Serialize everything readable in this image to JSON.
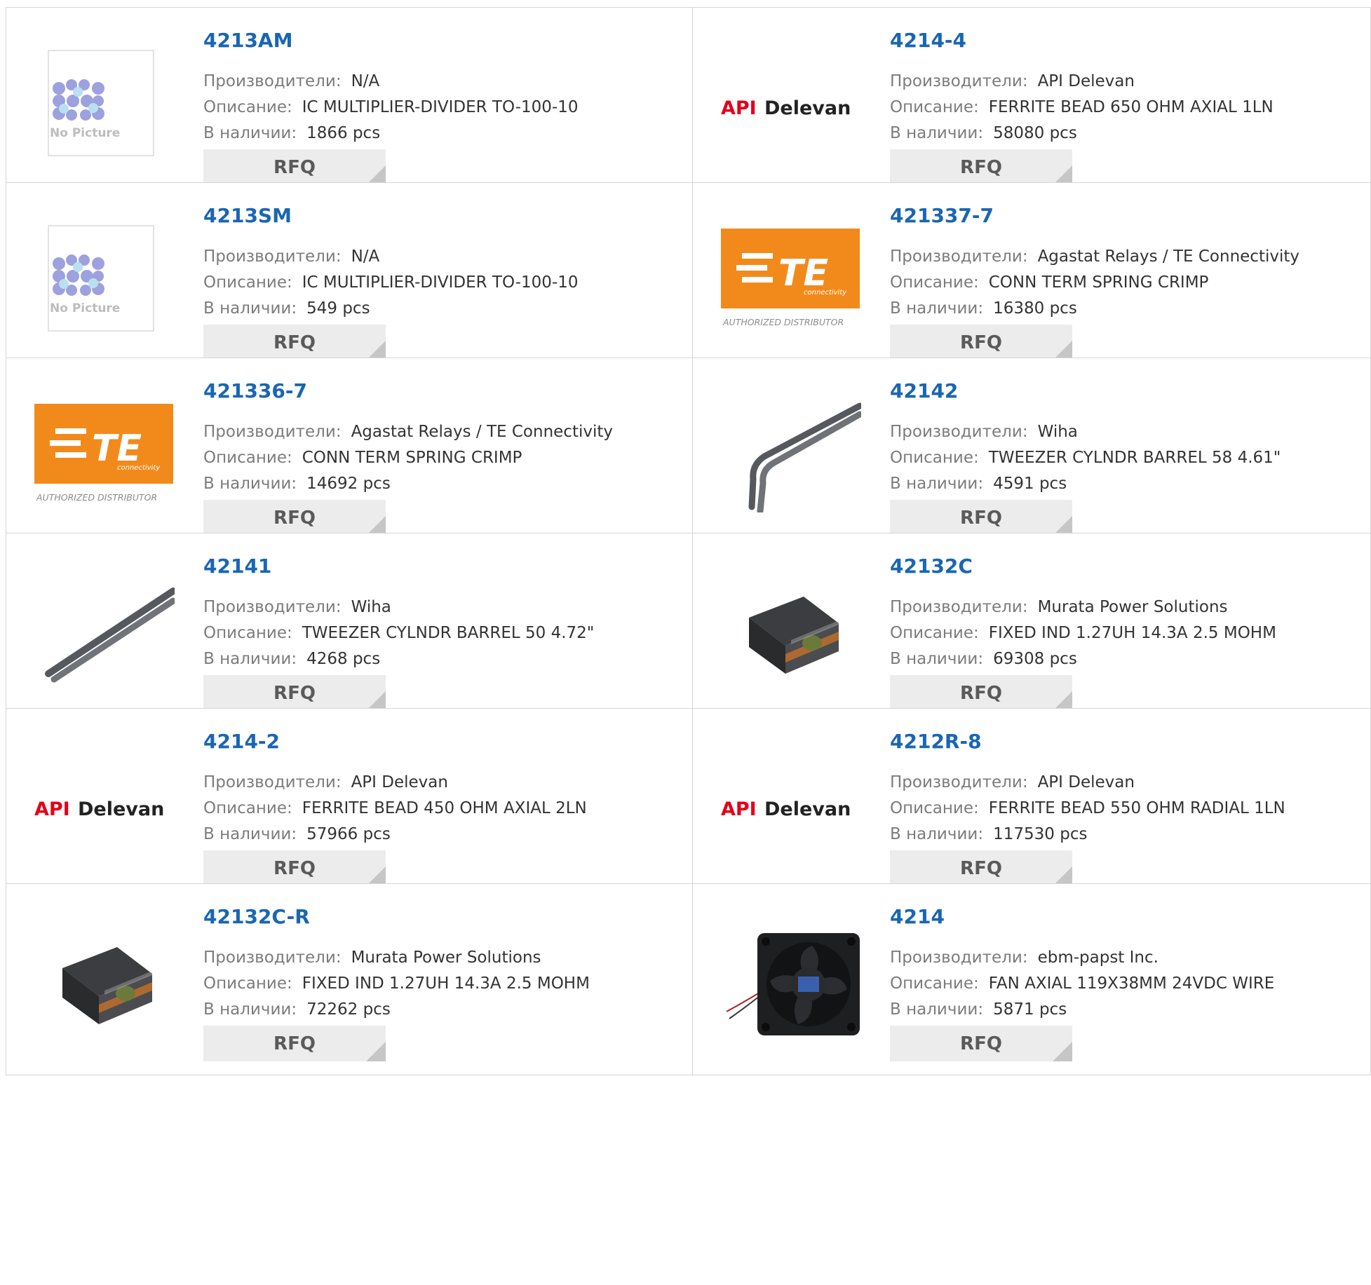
{
  "labels": {
    "manufacturer": "Производители:",
    "description": "Описание:",
    "stock": "В наличии:",
    "rfq": "RFQ"
  },
  "colors": {
    "part_link": "#1a66b3",
    "label": "#7c7c7c",
    "value": "#333333",
    "rfq_bg": "#ececec",
    "te_orange": "#f28a1b",
    "api_red": "#e3001b"
  },
  "image_texts": {
    "no_picture": "No Picture",
    "api": "API",
    "delevan": "Delevan",
    "te_name": "TE",
    "te_sub": "connectivity",
    "te_authorized": "AUTHORIZED DISTRIBUTOR"
  },
  "rows": [
    {
      "left": {
        "part": "4213AM",
        "manufacturer": "N/A",
        "description": "IC MULTIPLIER-DIVIDER TO-100-10",
        "stock": "1866 pcs",
        "image": "no-picture"
      },
      "right": {
        "part": "4214-4",
        "manufacturer": "API Delevan",
        "description": "FERRITE BEAD 650 OHM AXIAL 1LN",
        "stock": "58080 pcs",
        "image": "api-delevan-logo"
      }
    },
    {
      "left": {
        "part": "4213SM",
        "manufacturer": "N/A",
        "description": "IC MULTIPLIER-DIVIDER TO-100-10",
        "stock": "549 pcs",
        "image": "no-picture"
      },
      "right": {
        "part": "421337-7",
        "manufacturer": "Agastat Relays / TE Connectivity",
        "description": "CONN TERM SPRING CRIMP",
        "stock": "16380 pcs",
        "image": "te-logo"
      }
    },
    {
      "left": {
        "part": "421336-7",
        "manufacturer": "Agastat Relays / TE Connectivity",
        "description": "CONN TERM SPRING CRIMP",
        "stock": "14692 pcs",
        "image": "te-logo"
      },
      "right": {
        "part": "42142",
        "manufacturer": "Wiha",
        "description": "TWEEZER CYLNDR BARREL 58 4.61\"",
        "stock": "4591 pcs",
        "image": "tweezer-bent"
      }
    },
    {
      "left": {
        "part": "42141",
        "manufacturer": "Wiha",
        "description": "TWEEZER CYLNDR BARREL 50 4.72\"",
        "stock": "4268 pcs",
        "image": "tweezer-straight"
      },
      "right": {
        "part": "42132C",
        "manufacturer": "Murata Power Solutions",
        "description": "FIXED IND 1.27UH 14.3A 2.5 MOHM",
        "stock": "69308 pcs",
        "image": "inductor"
      }
    },
    {
      "left": {
        "part": "4214-2",
        "manufacturer": "API Delevan",
        "description": "FERRITE BEAD 450 OHM AXIAL 2LN",
        "stock": "57966 pcs",
        "image": "api-delevan-logo"
      },
      "right": {
        "part": "4212R-8",
        "manufacturer": "API Delevan",
        "description": "FERRITE BEAD 550 OHM RADIAL 1LN",
        "stock": "117530 pcs",
        "image": "api-delevan-logo"
      }
    },
    {
      "left": {
        "part": "42132C-R",
        "manufacturer": "Murata Power Solutions",
        "description": "FIXED IND 1.27UH 14.3A 2.5 MOHM",
        "stock": "72262 pcs",
        "image": "inductor"
      },
      "right": {
        "part": "4214",
        "manufacturer": "ebm-papst Inc.",
        "description": "FAN AXIAL 119X38MM 24VDC WIRE",
        "stock": "5871 pcs",
        "image": "axial-fan"
      }
    }
  ]
}
